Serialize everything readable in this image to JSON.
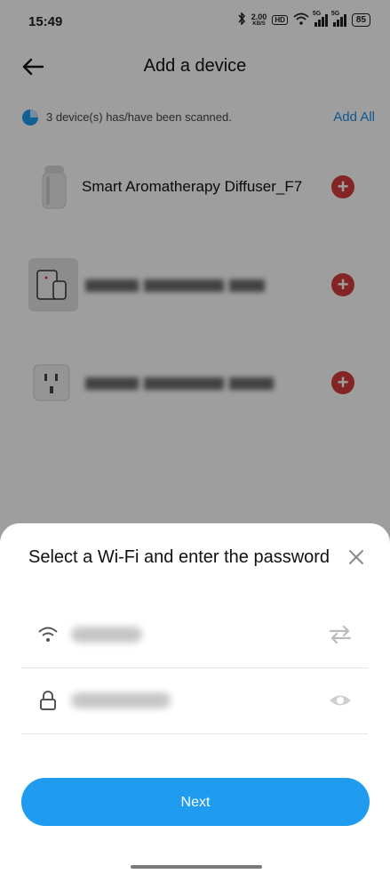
{
  "status_bar": {
    "time": "15:49",
    "speed_value": "2.00",
    "speed_unit": "KB/S",
    "hd_label": "HD",
    "sim1_label": "5G",
    "sim2_label": "5G",
    "battery": "85",
    "icons": [
      "bluetooth-icon",
      "wifi-icon",
      "signal-icon",
      "battery-icon"
    ]
  },
  "header": {
    "title": "Add a device",
    "back_icon": "back-arrow-icon"
  },
  "scan": {
    "text": "3 device(s) has/have been scanned.",
    "add_all": "Add All"
  },
  "devices": [
    {
      "name": "Smart Aromatherapy Diffuser_F7",
      "icon": "diffuser-icon",
      "name_obscured": false
    },
    {
      "name": "",
      "icon": "tablet-phone-icon",
      "name_obscured": true
    },
    {
      "name": "",
      "icon": "power-socket-icon",
      "name_obscured": true
    }
  ],
  "sheet": {
    "title": "Select a Wi-Fi and enter the password",
    "wifi_ssid_obscured": true,
    "password_obscured": true,
    "next_label": "Next",
    "icons": [
      "close-icon",
      "wifi-icon",
      "swap-icon",
      "lock-icon",
      "eye-icon"
    ]
  },
  "colors": {
    "accent": "#1f9bf0",
    "add_all": "#1a8ee8",
    "plus": "#d63c3c"
  }
}
